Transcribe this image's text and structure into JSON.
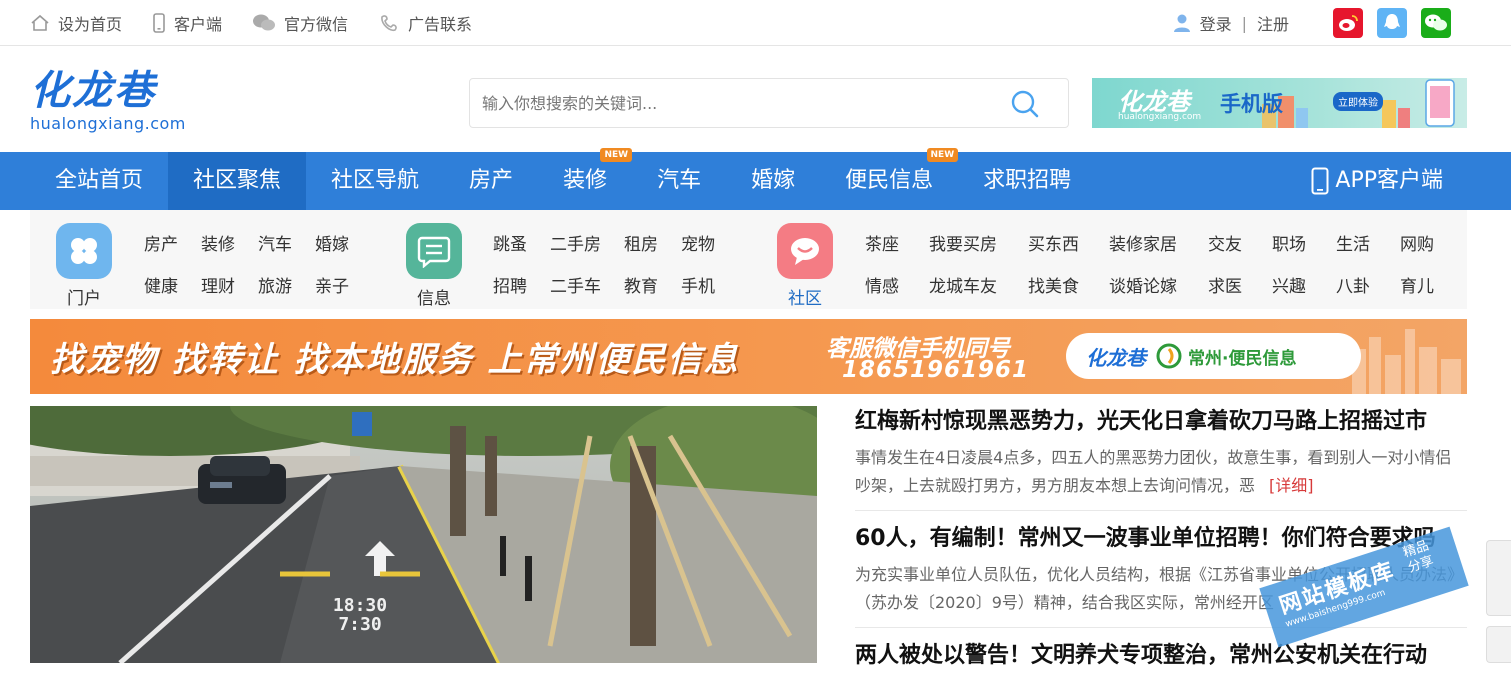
{
  "topbar": {
    "links": [
      {
        "label": "设为首页",
        "icon": "home-icon"
      },
      {
        "label": "客户端",
        "icon": "phone-icon"
      },
      {
        "label": "官方微信",
        "icon": "wechat-icon"
      },
      {
        "label": "广告联系",
        "icon": "headset-icon"
      }
    ],
    "login": "登录",
    "separator": "|",
    "register": "注册",
    "social": [
      {
        "icon": "weibo-icon",
        "color": "#e6162d"
      },
      {
        "icon": "qq-icon",
        "color": "#5fb4f5"
      },
      {
        "icon": "wechat-icon",
        "color": "#1aad19"
      }
    ]
  },
  "logo": {
    "cn": "化龙巷",
    "en": "hualongxiang.com"
  },
  "search": {
    "placeholder": "输入你想搜索的关键词..."
  },
  "app_banner": {
    "brand": "化龙巷",
    "title": "手机版",
    "domain": "hualongxiang.com",
    "cta": "立即体验"
  },
  "nav": {
    "items": [
      {
        "label": "全站首页",
        "active": false,
        "badge": ""
      },
      {
        "label": "社区聚焦",
        "active": true,
        "badge": ""
      },
      {
        "label": "社区导航",
        "active": false,
        "badge": ""
      },
      {
        "label": "房产",
        "active": false,
        "badge": ""
      },
      {
        "label": "装修",
        "active": false,
        "badge": "NEW"
      },
      {
        "label": "汽车",
        "active": false,
        "badge": ""
      },
      {
        "label": "婚嫁",
        "active": false,
        "badge": ""
      },
      {
        "label": "便民信息",
        "active": false,
        "badge": "NEW"
      },
      {
        "label": "求职招聘",
        "active": false,
        "badge": ""
      }
    ],
    "app_label": "APP客户端"
  },
  "quick": {
    "groups": [
      {
        "label": "门户",
        "icon": "clover-icon",
        "color": "#6fb6ee",
        "links": [
          "房产",
          "装修",
          "汽车",
          "婚嫁",
          "健康",
          "理财",
          "旅游",
          "亲子"
        ]
      },
      {
        "label": "信息",
        "icon": "message-list-icon",
        "color": "#55b59a",
        "links": [
          "跳蚤",
          "二手房",
          "租房",
          "宠物",
          "招聘",
          "二手车",
          "教育",
          "手机"
        ]
      },
      {
        "label": "社区",
        "icon": "chat-bubble-icon",
        "color": "#f47c84",
        "links": [
          "茶座",
          "我要买房",
          "买东西",
          "装修家居",
          "交友",
          "职场",
          "生活",
          "网购",
          "情感",
          "龙城车友",
          "找美食",
          "谈婚论嫁",
          "求医",
          "兴趣",
          "八卦",
          "育儿"
        ]
      }
    ]
  },
  "promo": {
    "headline": "找宠物 找转让 找本地服务 上常州便民信息",
    "service": "客服微信手机同号",
    "phone": "18651961961",
    "brand": "化龙巷",
    "brand_sub": "常州·便民信息"
  },
  "news": [
    {
      "title": "红梅新村惊现黑恶势力，光天化日拿着砍刀马路上招摇过市",
      "summary": "事情发生在4日凌晨4点多，四五人的黑恶势力团伙，故意生事，看到别人一对小情侣吵架，上去就殴打男方，男方朋友本想上去询问情况，恶",
      "detail": "[详细]"
    },
    {
      "title": "60人，有编制！常州又一波事业单位招聘！你们符合要求吗",
      "summary": "为充实事业单位人员队伍，优化人员结构，根据《江苏省事业单位公开招聘人员办法》（苏办发〔2020〕9号）精神，结合我区实际，常州经开区",
      "detail": ""
    },
    {
      "title": "两人被处以警告！文明养犬专项整治，常州公安机关在行动",
      "summary": "",
      "detail": ""
    }
  ],
  "photo": {
    "road_text_1": "18:30",
    "road_text_2": "7:30"
  },
  "watermark": {
    "title": "网站模板库",
    "url": "www.baisheng999.com",
    "tag1": "精品",
    "tag2": "分享"
  }
}
